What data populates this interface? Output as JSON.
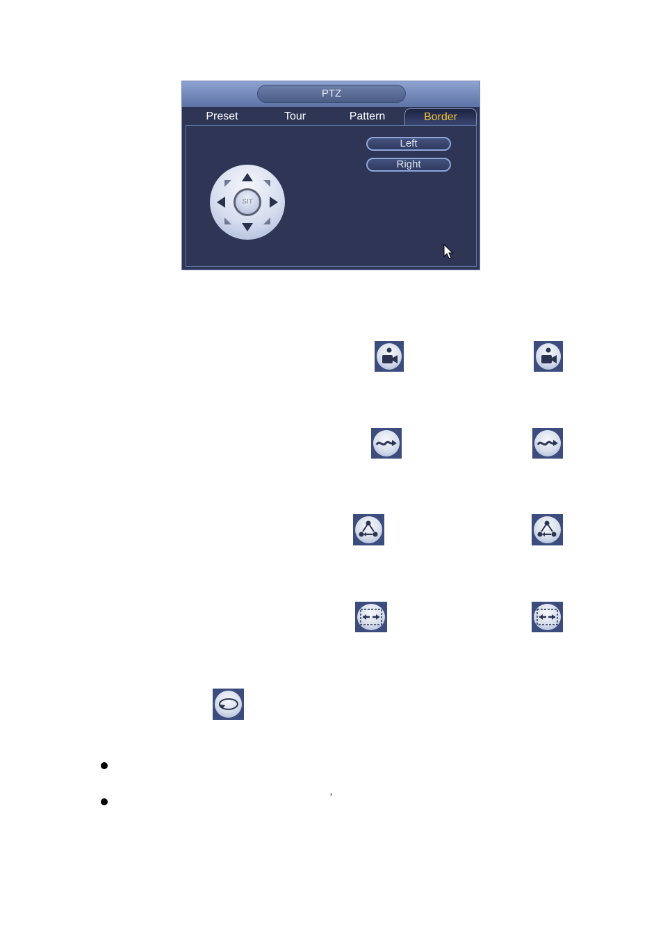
{
  "dialog": {
    "title": "PTZ",
    "tabs": [
      {
        "label": "Preset",
        "active": false
      },
      {
        "label": "Tour",
        "active": false
      },
      {
        "label": "Pattern",
        "active": false
      },
      {
        "label": "Border",
        "active": true
      }
    ],
    "dpad": {
      "center_label": "SIT"
    },
    "buttons": {
      "left": "Left",
      "right": "Right"
    },
    "colors": {
      "panel_bg": "#2e3555",
      "active_tab_text": "#f2c431",
      "titlebar": "#7489bb"
    }
  },
  "icons": [
    {
      "name": "preset-icon"
    },
    {
      "name": "tour-icon"
    },
    {
      "name": "pattern-icon"
    },
    {
      "name": "border-icon"
    },
    {
      "name": "rotate-icon"
    }
  ],
  "document": {
    "comma_text": "’"
  }
}
